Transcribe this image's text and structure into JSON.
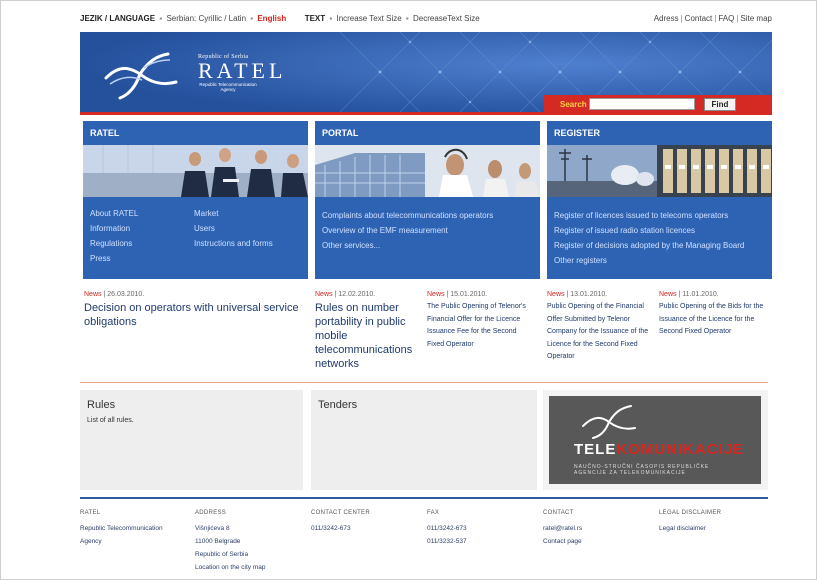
{
  "topbar": {
    "lang_label": "JEZIK / LANGUAGE",
    "lang_serbian": "Serbian: Cyrillic / Latin",
    "lang_english": "English",
    "text_label": "TEXT",
    "increase": "Increase Text Size",
    "decrease": "DecreaseText Size",
    "links": [
      "Adress",
      "Contact",
      "FAQ",
      "Site map"
    ]
  },
  "header": {
    "logo_small": "Republic of Serbia",
    "logo_big": "RATEL",
    "logo_tiny": "Republic Telecommunication Agency"
  },
  "search": {
    "label": "Search",
    "value": "",
    "button": "Find"
  },
  "panels": {
    "ratel": {
      "title": "RATEL",
      "links_left": [
        "About RATEL",
        "Information",
        "Regulations",
        "Press"
      ],
      "links_right": [
        "Market",
        "Users",
        "Instructions and forms"
      ]
    },
    "portal": {
      "title": "PORTAL",
      "links": [
        "Complaints about telecommunications operators",
        "Overview of the EMF measurement",
        "Other services..."
      ]
    },
    "register": {
      "title": "REGISTER",
      "links": [
        "Register of licences issued to telecoms operators",
        "Register of issued radio station licences",
        "Register of decisions adopted by the Managing Board",
        "Other registers"
      ]
    }
  },
  "news": [
    {
      "tag": "News",
      "date": "26.03.2010.",
      "title": "Decision on operators with universal service obligations"
    },
    {
      "tag": "News",
      "date": "12.02.2010.",
      "title": "Rules on number portability in public mobile telecommunications networks"
    },
    {
      "tag": "News",
      "date": "15.01.2010.",
      "title": "The Public Opening of Telenor's Financial Offer for the Licence Issuance Fee for the Second Fixed Operator"
    },
    {
      "tag": "News",
      "date": "13.01.2010.",
      "title": "Public Opening of the Financial Offer Submitted by Telenor Company for the Issuance of the Licence for the Second Fixed Operator"
    },
    {
      "tag": "News",
      "date": "11.01.2010.",
      "title": "Public Opening of the Bids for the Issuance of the Licence for the Second Fixed Operator"
    }
  ],
  "boxes": {
    "rules_title": "Rules",
    "rules_sub": "List of all rules.",
    "tenders_title": "Tenders"
  },
  "telekom": {
    "tele": "TELE",
    "komunikacije": "KOMUNIKACIJE",
    "sub1": "NAUČNO-STRUČNI ČASOPIS REPUBLIČKE",
    "sub2": "AGENCIJE ZA TELEKOMUNIKACIJE"
  },
  "footer": {
    "ratel": {
      "heading": "RATEL",
      "lines": [
        "Republic Telecommunication",
        "Agency"
      ]
    },
    "address": {
      "heading": "ADDRESS",
      "lines": [
        "Višnjićeva 8",
        "11000 Belgrade",
        "Republic of Serbia",
        "Location on the city map"
      ]
    },
    "contact_center": {
      "heading": "CONTACT CENTER",
      "lines": [
        "011/3242-673"
      ]
    },
    "fax": {
      "heading": "FAX",
      "lines": [
        "011/3242-673",
        "011/3232-537"
      ]
    },
    "contact": {
      "heading": "CONTACT",
      "lines": [
        "ratel@ratel.rs",
        "Contact page"
      ]
    },
    "legal": {
      "heading": "LEGAL DISCLAIMER",
      "lines": [
        "Legal disclaimer"
      ]
    }
  },
  "colors": {
    "brand_blue": "#2e63b4",
    "accent_red": "#d42a23"
  }
}
